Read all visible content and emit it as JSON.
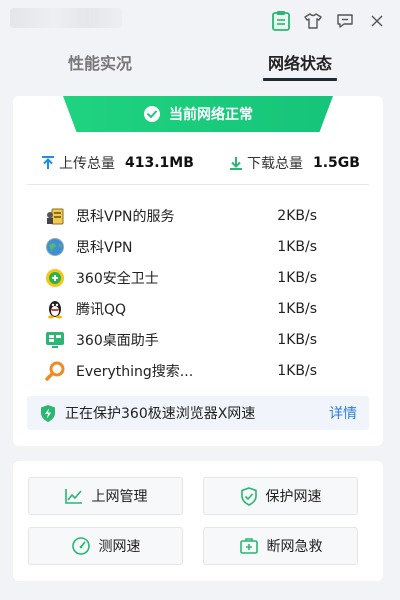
{
  "titlebar": {
    "icons": [
      "clipboard-icon",
      "shirt-icon",
      "feedback-icon",
      "close-icon"
    ]
  },
  "tabs": [
    {
      "label": "性能实况",
      "active": false
    },
    {
      "label": "网络状态",
      "active": true
    }
  ],
  "banner": {
    "text": "当前网络正常"
  },
  "totals": {
    "upload_label": "上传总量",
    "upload_value": "413.1MB",
    "download_label": "下载总量",
    "download_value": "1.5GB"
  },
  "processes": [
    {
      "name": "思科VPN的服务",
      "speed": "2KB/s",
      "icon": "vpn-service-icon"
    },
    {
      "name": "思科VPN",
      "speed": "1KB/s",
      "icon": "vpn-globe-icon"
    },
    {
      "name": "360安全卫士",
      "speed": "1KB/s",
      "icon": "360-security-icon"
    },
    {
      "name": "腾讯QQ",
      "speed": "1KB/s",
      "icon": "qq-penguin-icon"
    },
    {
      "name": "360桌面助手",
      "speed": "1KB/s",
      "icon": "desktop-assistant-icon"
    },
    {
      "name": "Everything搜索...",
      "speed": "1KB/s",
      "icon": "everything-search-icon"
    }
  ],
  "protect": {
    "text": "正在保护360极速浏览器X网速",
    "link": "详情"
  },
  "actions": {
    "internet_manage": "上网管理",
    "protect_speed": "保护网速",
    "speed_test": "测网速",
    "network_rescue": "断网急救"
  },
  "colors": {
    "accent_green": "#1fd37f",
    "link_blue": "#2b7de0",
    "icon_green": "#2bb673"
  }
}
